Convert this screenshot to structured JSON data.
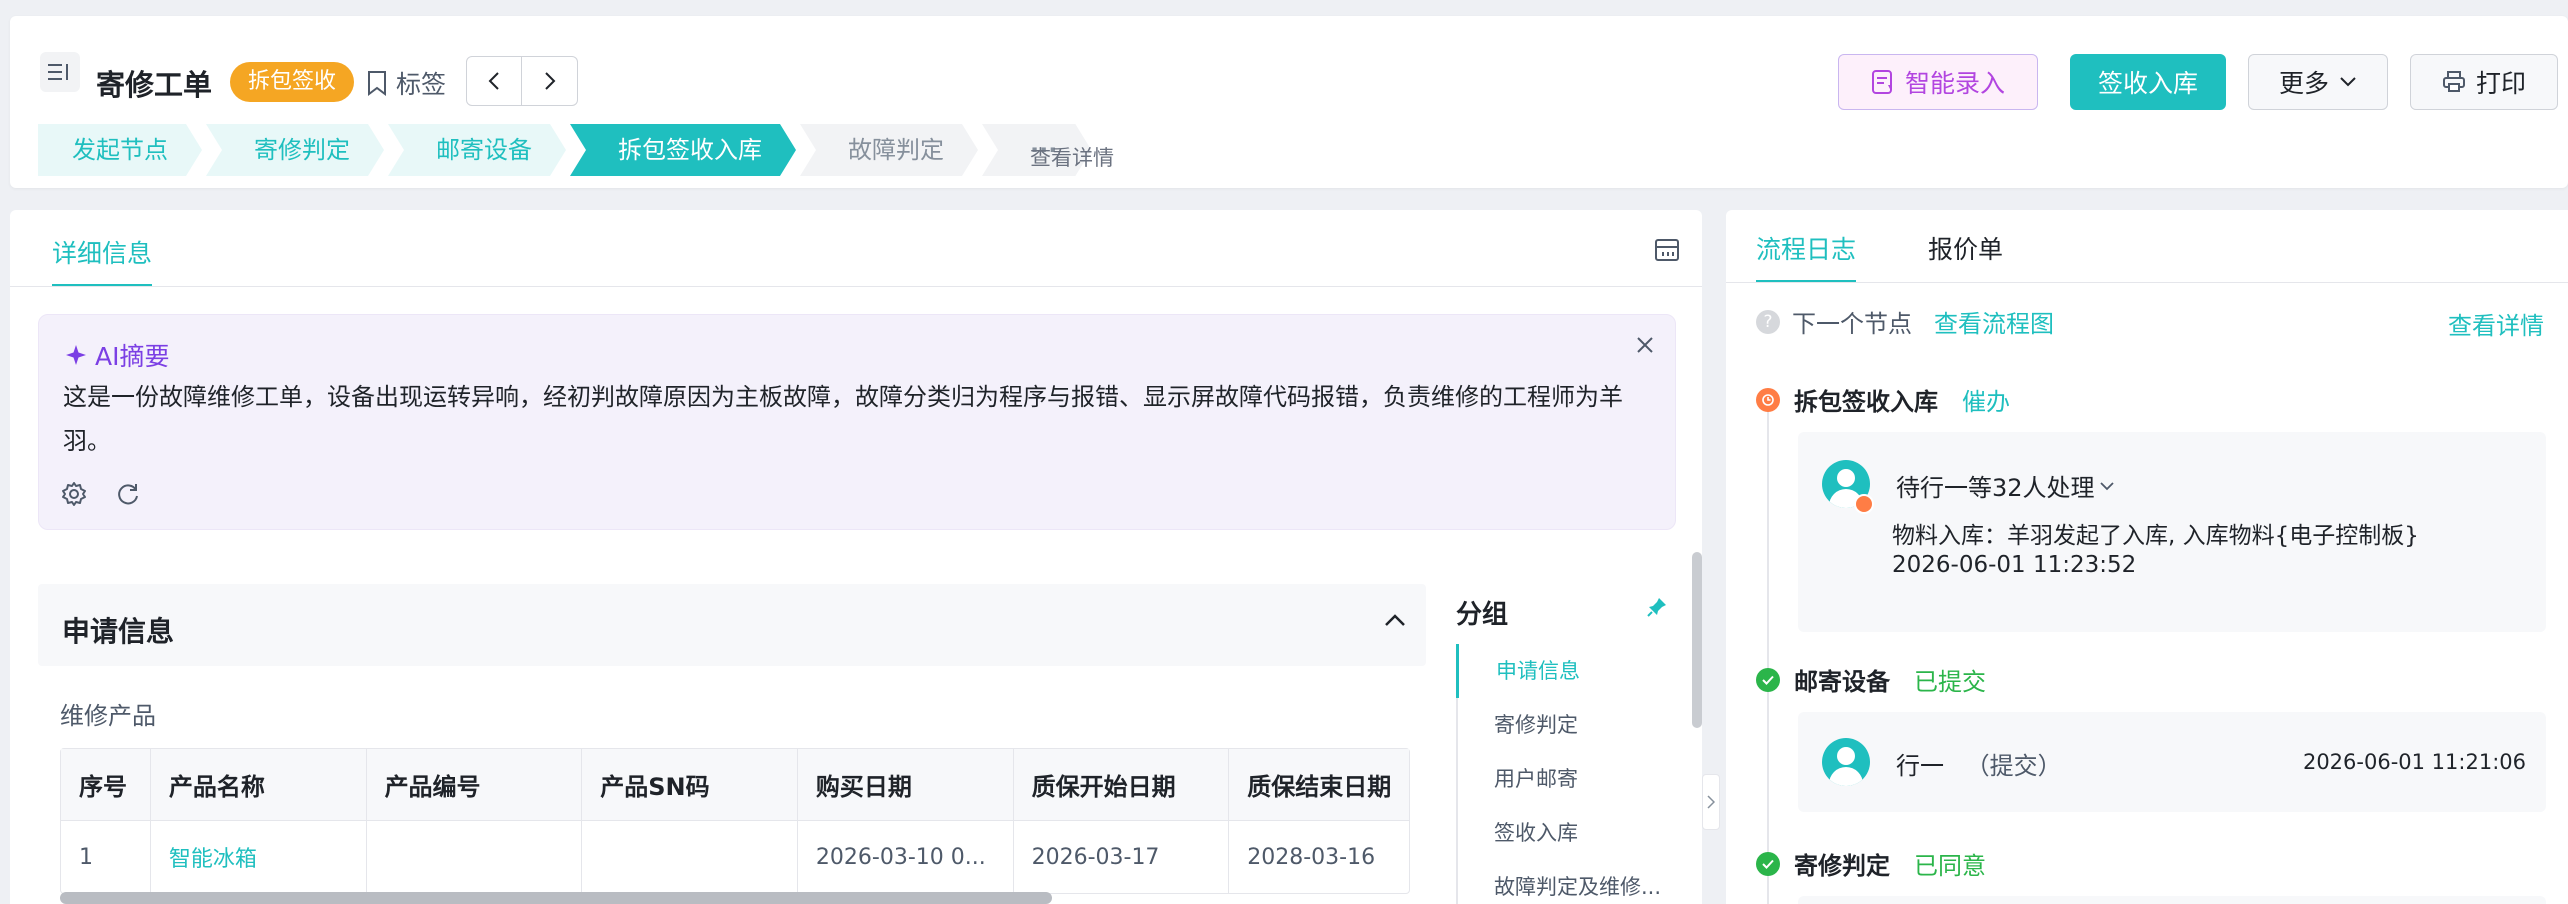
{
  "header": {
    "title": "寄修工单",
    "status_badge": "拆包签收",
    "tag_label": "标签",
    "buttons": {
      "ai_entry": "智能录入",
      "sign_in": "签收入库",
      "more": "更多",
      "print": "打印"
    },
    "steps": [
      {
        "label": "发起节点",
        "state": "done"
      },
      {
        "label": "寄修判定",
        "state": "done"
      },
      {
        "label": "邮寄设备",
        "state": "done"
      },
      {
        "label": "拆包签收入库",
        "state": "current"
      },
      {
        "label": "故障判定",
        "state": "todo"
      },
      {
        "label": "···",
        "state": "todo"
      }
    ],
    "view_detail": "查看详情"
  },
  "left": {
    "tab": "详细信息",
    "ai_summary": {
      "title": "AI摘要",
      "text": "这是一份故障维修工单，设备出现运转异响，经初判故障原因为主板故障，故障分类归为程序与报错、显示屏故障代码报错，负责维修的工程师为羊羽。"
    },
    "section_title": "申请信息",
    "sub_label": "维修产品",
    "table": {
      "headers": [
        "序号",
        "产品名称",
        "产品编号",
        "产品SN码",
        "购买日期",
        "质保开始日期",
        "质保结束日期"
      ],
      "rows": [
        [
          "1",
          "智能冰箱",
          "",
          "",
          "2026-03-10 0...",
          "2026-03-17",
          "2028-03-16"
        ]
      ]
    },
    "groups": {
      "title": "分组",
      "items": [
        "申请信息",
        "寄修判定",
        "用户邮寄",
        "签收入库",
        "故障判定及维修..."
      ]
    }
  },
  "right": {
    "tabs": [
      "流程日志",
      "报价单"
    ],
    "next_node_label": "下一个节点",
    "view_flow": "查看流程图",
    "view_detail": "查看详情",
    "timeline": [
      {
        "title": "拆包签收入库",
        "status": "催办",
        "assignee": "待行一等32人处理",
        "line1": "物料入库：羊羽发起了入库, 入库物料{电子控制板}",
        "time": "2026-06-01 11:23:52"
      },
      {
        "title": "邮寄设备",
        "status": "已提交",
        "person": "行一",
        "action": "（提交）",
        "time": "2026-06-01 11:21:06"
      },
      {
        "title": "寄修判定",
        "status": "已同意"
      }
    ]
  },
  "colors": {
    "primary": "#1fbfbf",
    "badge": "#f5a623",
    "ai_accent": "#7b3fe4",
    "success": "#2bb54a",
    "warning": "#ff7d45"
  }
}
